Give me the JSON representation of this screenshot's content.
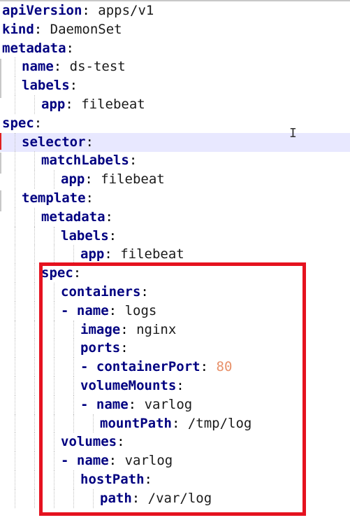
{
  "editor": {
    "lines": [
      {
        "indent": 0,
        "dash": false,
        "key": "apiVersion",
        "value": "apps/v1",
        "value_type": "str"
      },
      {
        "indent": 0,
        "dash": false,
        "key": "kind",
        "value": "DaemonSet",
        "value_type": "str"
      },
      {
        "indent": 0,
        "dash": false,
        "key": "metadata",
        "value": "",
        "value_type": "str"
      },
      {
        "indent": 1,
        "dash": false,
        "key": "name",
        "value": "ds-test",
        "value_type": "str"
      },
      {
        "indent": 1,
        "dash": false,
        "key": "labels",
        "value": "",
        "value_type": "str"
      },
      {
        "indent": 2,
        "dash": false,
        "key": "app",
        "value": "filebeat",
        "value_type": "str"
      },
      {
        "indent": 0,
        "dash": false,
        "key": "spec",
        "value": "",
        "value_type": "str"
      },
      {
        "indent": 1,
        "dash": false,
        "key": "selector",
        "value": "",
        "value_type": "str"
      },
      {
        "indent": 2,
        "dash": false,
        "key": "matchLabels",
        "value": "",
        "value_type": "str"
      },
      {
        "indent": 3,
        "dash": false,
        "key": "app",
        "value": "filebeat",
        "value_type": "str"
      },
      {
        "indent": 1,
        "dash": false,
        "key": "template",
        "value": "",
        "value_type": "str"
      },
      {
        "indent": 2,
        "dash": false,
        "key": "metadata",
        "value": "",
        "value_type": "str"
      },
      {
        "indent": 3,
        "dash": false,
        "key": "labels",
        "value": "",
        "value_type": "str"
      },
      {
        "indent": 4,
        "dash": false,
        "key": "app",
        "value": "filebeat",
        "value_type": "str"
      },
      {
        "indent": 2,
        "dash": false,
        "key": "spec",
        "value": "",
        "value_type": "str"
      },
      {
        "indent": 3,
        "dash": false,
        "key": "containers",
        "value": "",
        "value_type": "str"
      },
      {
        "indent": 3,
        "dash": true,
        "key": "name",
        "value": "logs",
        "value_type": "str"
      },
      {
        "indent": 4,
        "dash": false,
        "key": "image",
        "value": "nginx",
        "value_type": "str"
      },
      {
        "indent": 4,
        "dash": false,
        "key": "ports",
        "value": "",
        "value_type": "str"
      },
      {
        "indent": 4,
        "dash": true,
        "key": "containerPort",
        "value": "80",
        "value_type": "num"
      },
      {
        "indent": 4,
        "dash": false,
        "key": "volumeMounts",
        "value": "",
        "value_type": "str"
      },
      {
        "indent": 4,
        "dash": true,
        "key": "name",
        "value": "varlog",
        "value_type": "str"
      },
      {
        "indent": 5,
        "dash": false,
        "key": "mountPath",
        "value": "/tmp/log",
        "value_type": "str"
      },
      {
        "indent": 3,
        "dash": false,
        "key": "volumes",
        "value": "",
        "value_type": "str"
      },
      {
        "indent": 3,
        "dash": true,
        "key": "name",
        "value": "varlog",
        "value_type": "str"
      },
      {
        "indent": 4,
        "dash": false,
        "key": "hostPath",
        "value": "",
        "value_type": "str"
      },
      {
        "indent": 5,
        "dash": false,
        "key": "path",
        "value": "/var/log",
        "value_type": "str"
      }
    ],
    "current_line_index": 7,
    "colors": {
      "key": "#000080",
      "number": "#e8916a",
      "current_line": "#e8e8ff",
      "highlight_box": "#e5121f"
    },
    "cursor_icon": "text-cursor-icon",
    "cursor_glyph": "I"
  }
}
